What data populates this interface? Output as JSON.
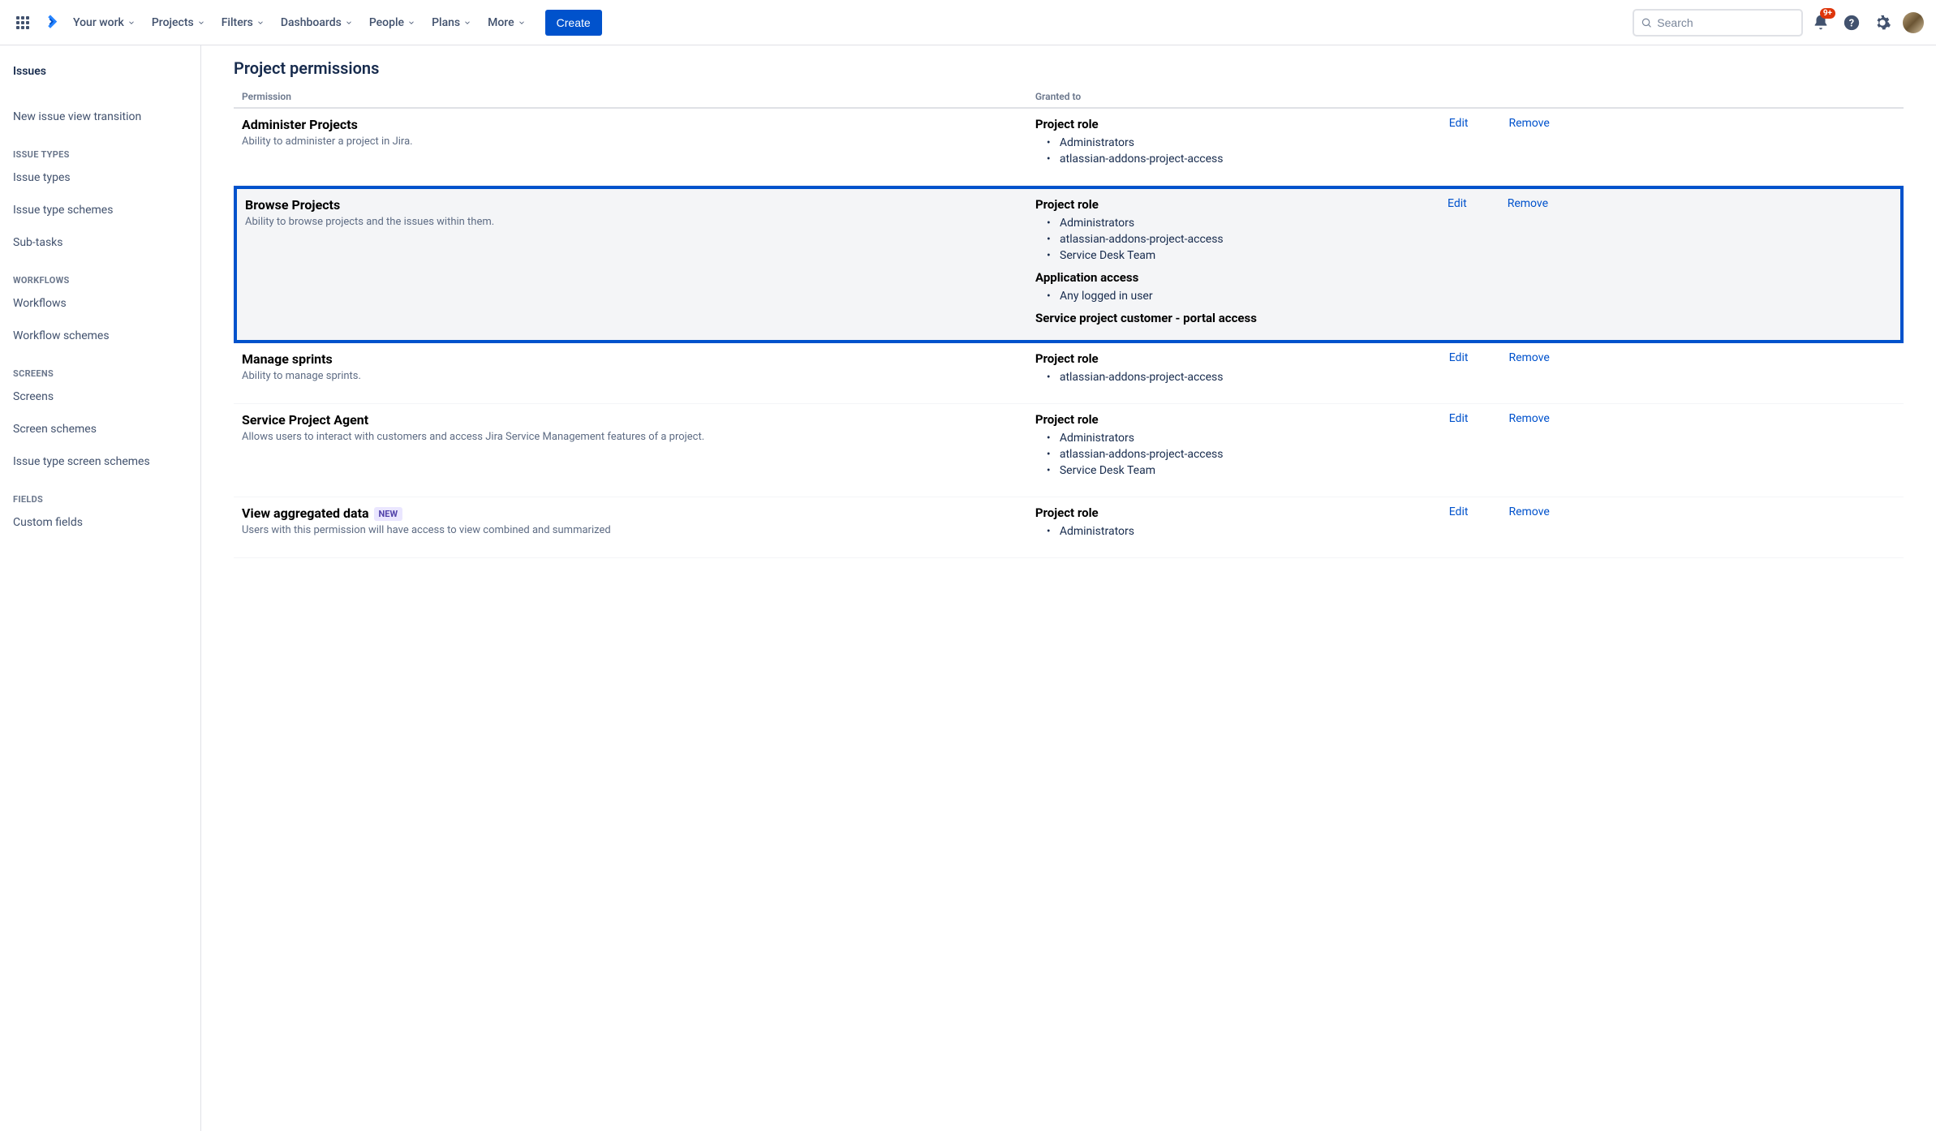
{
  "topnav": {
    "items": [
      {
        "label": "Your work"
      },
      {
        "label": "Projects"
      },
      {
        "label": "Filters"
      },
      {
        "label": "Dashboards"
      },
      {
        "label": "People"
      },
      {
        "label": "Plans"
      },
      {
        "label": "More"
      }
    ],
    "create_label": "Create",
    "search_placeholder": "Search",
    "notification_badge": "9+"
  },
  "sidebar": {
    "top_item": "Issues",
    "new_issue": "New issue view transition",
    "sections": [
      {
        "header": "ISSUE TYPES",
        "items": [
          "Issue types",
          "Issue type schemes",
          "Sub-tasks"
        ]
      },
      {
        "header": "WORKFLOWS",
        "items": [
          "Workflows",
          "Workflow schemes"
        ]
      },
      {
        "header": "SCREENS",
        "items": [
          "Screens",
          "Screen schemes",
          "Issue type screen schemes"
        ]
      },
      {
        "header": "FIELDS",
        "items": [
          "Custom fields"
        ]
      }
    ]
  },
  "main": {
    "title": "Project permissions",
    "table_headers": {
      "permission": "Permission",
      "granted_to": "Granted to"
    },
    "edit_label": "Edit",
    "remove_label": "Remove",
    "new_badge": "NEW",
    "permissions": [
      {
        "name": "Administer Projects",
        "desc": "Ability to administer a project in Jira.",
        "highlighted": false,
        "granted": [
          {
            "title": "Project role",
            "items": [
              "Administrators",
              "atlassian-addons-project-access"
            ]
          }
        ]
      },
      {
        "name": "Browse Projects",
        "desc": "Ability to browse projects and the issues within them.",
        "highlighted": true,
        "granted": [
          {
            "title": "Project role",
            "items": [
              "Administrators",
              "atlassian-addons-project-access",
              "Service Desk Team"
            ]
          },
          {
            "title": "Application access",
            "items": [
              "Any logged in user"
            ]
          },
          {
            "title": "Service project customer - portal access",
            "items": []
          }
        ]
      },
      {
        "name": "Manage sprints",
        "desc": "Ability to manage sprints.",
        "highlighted": false,
        "granted": [
          {
            "title": "Project role",
            "items": [
              "atlassian-addons-project-access"
            ]
          }
        ]
      },
      {
        "name": "Service Project Agent",
        "desc": "Allows users to interact with customers and access Jira Service Management features of a project.",
        "highlighted": false,
        "granted": [
          {
            "title": "Project role",
            "items": [
              "Administrators",
              "atlassian-addons-project-access",
              "Service Desk Team"
            ]
          }
        ]
      },
      {
        "name": "View aggregated data",
        "desc": "Users with this permission will have access to view combined and summarized",
        "highlighted": false,
        "new": true,
        "granted": [
          {
            "title": "Project role",
            "items": [
              "Administrators"
            ]
          }
        ]
      }
    ]
  }
}
